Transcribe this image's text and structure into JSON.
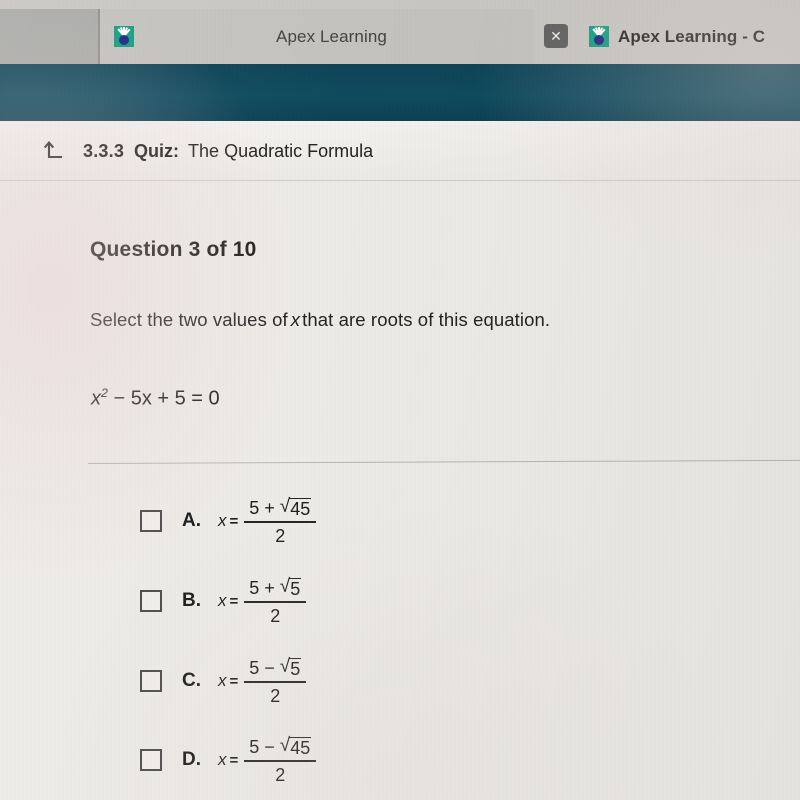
{
  "browser": {
    "tabs": [
      {
        "title": "Apex Learning",
        "favicon": "apex-favicon",
        "active": true
      },
      {
        "title": "Apex Learning - C",
        "favicon": "apex-favicon",
        "active": false
      }
    ],
    "close_tab_label": "✕"
  },
  "header": {
    "back_icon": "back-up-arrow-icon",
    "lesson_number": "3.3.3",
    "activity_type": "Quiz:",
    "activity_name": "The Quadratic Formula",
    "band_color": "#0e4a5e"
  },
  "question": {
    "title": "Question 3 of 10",
    "prompt_before": "Select the two values of",
    "prompt_variable": "x",
    "prompt_after": "that are roots of this equation.",
    "equation": {
      "base": "x",
      "exponent": "2",
      "rest": "− 5x + 5 = 0"
    }
  },
  "options": [
    {
      "letter": "A.",
      "lhs": "x",
      "equals": "=",
      "numerator_first": "5",
      "numerator_sign": "+",
      "radicand": "45",
      "denominator": "2",
      "checked": false
    },
    {
      "letter": "B.",
      "lhs": "x",
      "equals": "=",
      "numerator_first": "5",
      "numerator_sign": "+",
      "radicand": "5",
      "denominator": "2",
      "checked": false
    },
    {
      "letter": "C.",
      "lhs": "x",
      "equals": "=",
      "numerator_first": "5",
      "numerator_sign": "−",
      "radicand": "5",
      "denominator": "2",
      "checked": false
    },
    {
      "letter": "D.",
      "lhs": "x",
      "equals": "=",
      "numerator_first": "5",
      "numerator_sign": "−",
      "radicand": "45",
      "denominator": "2",
      "checked": false
    }
  ],
  "symbols": {
    "radical": "√"
  }
}
